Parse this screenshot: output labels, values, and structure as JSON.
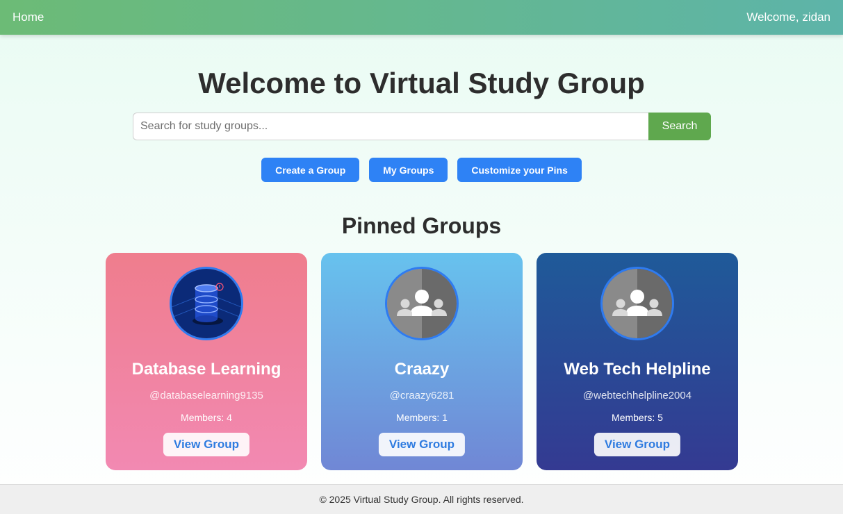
{
  "nav": {
    "home_label": "Home",
    "welcome_text": "Welcome, zidan"
  },
  "main": {
    "title": "Welcome to Virtual Study Group",
    "search": {
      "placeholder": "Search for study groups...",
      "value": "",
      "button_label": "Search"
    },
    "actions": [
      {
        "label": "Create a Group"
      },
      {
        "label": "My Groups"
      },
      {
        "label": "Customize your Pins"
      }
    ],
    "pinned_title": "Pinned Groups",
    "groups": [
      {
        "name": "Database Learning",
        "handle": "@databaselearning9135",
        "members": "Members: 4",
        "avatar_icon": "database-icon",
        "button_label": "View Group"
      },
      {
        "name": "Craazy",
        "handle": "@craazy6281",
        "members": "Members: 1",
        "avatar_icon": "group-people-icon",
        "button_label": "View Group"
      },
      {
        "name": "Web Tech Helpline",
        "handle": "@webtechhelpline2004",
        "members": "Members: 5",
        "avatar_icon": "group-people-icon",
        "button_label": "View Group"
      }
    ]
  },
  "footer": {
    "text": "© 2025 Virtual Study Group. All rights reserved."
  },
  "colors": {
    "nav_gradient_start": "#6cbb76",
    "nav_gradient_end": "#5db4a9",
    "search_button": "#5fa84e",
    "action_button": "#2e82f5",
    "card1": "#ef7d8d",
    "card2": "#67c2ee",
    "card3": "#1f5a99"
  }
}
